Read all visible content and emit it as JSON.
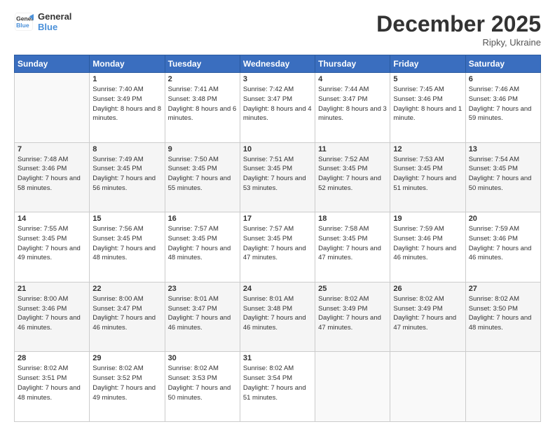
{
  "header": {
    "logo_line1": "General",
    "logo_line2": "Blue",
    "month": "December 2025",
    "location": "Ripky, Ukraine"
  },
  "days_of_week": [
    "Sunday",
    "Monday",
    "Tuesday",
    "Wednesday",
    "Thursday",
    "Friday",
    "Saturday"
  ],
  "weeks": [
    [
      {
        "day": "",
        "info": ""
      },
      {
        "day": "1",
        "sunrise": "7:40 AM",
        "sunset": "3:49 PM",
        "daylight": "8 hours and 8 minutes."
      },
      {
        "day": "2",
        "sunrise": "7:41 AM",
        "sunset": "3:48 PM",
        "daylight": "8 hours and 6 minutes."
      },
      {
        "day": "3",
        "sunrise": "7:42 AM",
        "sunset": "3:47 PM",
        "daylight": "8 hours and 4 minutes."
      },
      {
        "day": "4",
        "sunrise": "7:44 AM",
        "sunset": "3:47 PM",
        "daylight": "8 hours and 3 minutes."
      },
      {
        "day": "5",
        "sunrise": "7:45 AM",
        "sunset": "3:46 PM",
        "daylight": "8 hours and 1 minute."
      },
      {
        "day": "6",
        "sunrise": "7:46 AM",
        "sunset": "3:46 PM",
        "daylight": "7 hours and 59 minutes."
      }
    ],
    [
      {
        "day": "7",
        "sunrise": "7:48 AM",
        "sunset": "3:46 PM",
        "daylight": "7 hours and 58 minutes."
      },
      {
        "day": "8",
        "sunrise": "7:49 AM",
        "sunset": "3:45 PM",
        "daylight": "7 hours and 56 minutes."
      },
      {
        "day": "9",
        "sunrise": "7:50 AM",
        "sunset": "3:45 PM",
        "daylight": "7 hours and 55 minutes."
      },
      {
        "day": "10",
        "sunrise": "7:51 AM",
        "sunset": "3:45 PM",
        "daylight": "7 hours and 53 minutes."
      },
      {
        "day": "11",
        "sunrise": "7:52 AM",
        "sunset": "3:45 PM",
        "daylight": "7 hours and 52 minutes."
      },
      {
        "day": "12",
        "sunrise": "7:53 AM",
        "sunset": "3:45 PM",
        "daylight": "7 hours and 51 minutes."
      },
      {
        "day": "13",
        "sunrise": "7:54 AM",
        "sunset": "3:45 PM",
        "daylight": "7 hours and 50 minutes."
      }
    ],
    [
      {
        "day": "14",
        "sunrise": "7:55 AM",
        "sunset": "3:45 PM",
        "daylight": "7 hours and 49 minutes."
      },
      {
        "day": "15",
        "sunrise": "7:56 AM",
        "sunset": "3:45 PM",
        "daylight": "7 hours and 48 minutes."
      },
      {
        "day": "16",
        "sunrise": "7:57 AM",
        "sunset": "3:45 PM",
        "daylight": "7 hours and 48 minutes."
      },
      {
        "day": "17",
        "sunrise": "7:57 AM",
        "sunset": "3:45 PM",
        "daylight": "7 hours and 47 minutes."
      },
      {
        "day": "18",
        "sunrise": "7:58 AM",
        "sunset": "3:45 PM",
        "daylight": "7 hours and 47 minutes."
      },
      {
        "day": "19",
        "sunrise": "7:59 AM",
        "sunset": "3:46 PM",
        "daylight": "7 hours and 46 minutes."
      },
      {
        "day": "20",
        "sunrise": "7:59 AM",
        "sunset": "3:46 PM",
        "daylight": "7 hours and 46 minutes."
      }
    ],
    [
      {
        "day": "21",
        "sunrise": "8:00 AM",
        "sunset": "3:46 PM",
        "daylight": "7 hours and 46 minutes."
      },
      {
        "day": "22",
        "sunrise": "8:00 AM",
        "sunset": "3:47 PM",
        "daylight": "7 hours and 46 minutes."
      },
      {
        "day": "23",
        "sunrise": "8:01 AM",
        "sunset": "3:47 PM",
        "daylight": "7 hours and 46 minutes."
      },
      {
        "day": "24",
        "sunrise": "8:01 AM",
        "sunset": "3:48 PM",
        "daylight": "7 hours and 46 minutes."
      },
      {
        "day": "25",
        "sunrise": "8:02 AM",
        "sunset": "3:49 PM",
        "daylight": "7 hours and 47 minutes."
      },
      {
        "day": "26",
        "sunrise": "8:02 AM",
        "sunset": "3:49 PM",
        "daylight": "7 hours and 47 minutes."
      },
      {
        "day": "27",
        "sunrise": "8:02 AM",
        "sunset": "3:50 PM",
        "daylight": "7 hours and 48 minutes."
      }
    ],
    [
      {
        "day": "28",
        "sunrise": "8:02 AM",
        "sunset": "3:51 PM",
        "daylight": "7 hours and 48 minutes."
      },
      {
        "day": "29",
        "sunrise": "8:02 AM",
        "sunset": "3:52 PM",
        "daylight": "7 hours and 49 minutes."
      },
      {
        "day": "30",
        "sunrise": "8:02 AM",
        "sunset": "3:53 PM",
        "daylight": "7 hours and 50 minutes."
      },
      {
        "day": "31",
        "sunrise": "8:02 AM",
        "sunset": "3:54 PM",
        "daylight": "7 hours and 51 minutes."
      },
      {
        "day": "",
        "info": ""
      },
      {
        "day": "",
        "info": ""
      },
      {
        "day": "",
        "info": ""
      }
    ]
  ],
  "labels": {
    "sunrise": "Sunrise:",
    "sunset": "Sunset:",
    "daylight": "Daylight:"
  }
}
